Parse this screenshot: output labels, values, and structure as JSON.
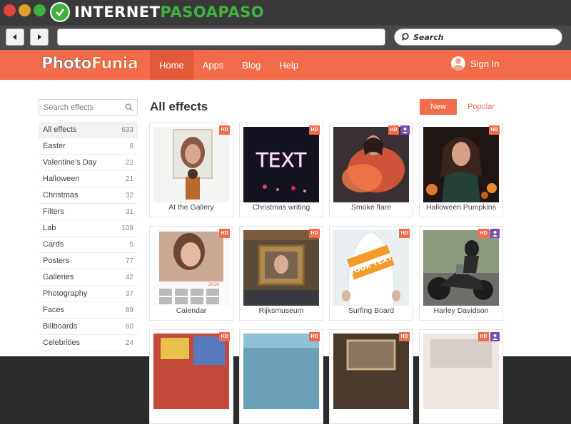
{
  "browser": {
    "brand_prefix": "INTERNET",
    "brand_accent": "PASOAPASO",
    "search_label": "Search",
    "url_value": ""
  },
  "header": {
    "logo_photo": "Photo",
    "logo_funia": "Funia",
    "nav": [
      "Home",
      "Apps",
      "Blog",
      "Help"
    ],
    "active_nav": "Home",
    "signin_label": "Sign In",
    "accent_color": "#f26b4a"
  },
  "sidebar": {
    "search_placeholder": "Search effects",
    "items": [
      {
        "label": "All effects",
        "count": "633"
      },
      {
        "label": "Easter",
        "count": "8"
      },
      {
        "label": "Valentine's Day",
        "count": "22"
      },
      {
        "label": "Halloween",
        "count": "21"
      },
      {
        "label": "Christmas",
        "count": "32"
      },
      {
        "label": "Filters",
        "count": "31"
      },
      {
        "label": "Lab",
        "count": "109"
      },
      {
        "label": "Cards",
        "count": "5"
      },
      {
        "label": "Posters",
        "count": "77"
      },
      {
        "label": "Galleries",
        "count": "42"
      },
      {
        "label": "Photography",
        "count": "37"
      },
      {
        "label": "Faces",
        "count": "89"
      },
      {
        "label": "Billboards",
        "count": "60"
      },
      {
        "label": "Celebrities",
        "count": "24"
      }
    ]
  },
  "main": {
    "title": "All effects",
    "new_label": "New",
    "popular_label": "Popular",
    "cards": [
      {
        "label": "At the Gallery",
        "hd": "HD",
        "user_badge": false
      },
      {
        "label": "Christmas writing",
        "hd": "HD",
        "user_badge": false
      },
      {
        "label": "Smoke flare",
        "hd": "HD",
        "user_badge": true
      },
      {
        "label": "Halloween Pumpkins",
        "hd": "HD",
        "user_badge": false
      },
      {
        "label": "Calendar",
        "hd": "HD",
        "user_badge": false
      },
      {
        "label": "Rijksmuseum",
        "hd": "HD",
        "user_badge": false
      },
      {
        "label": "Surfing Board",
        "hd": "HD",
        "user_badge": false
      },
      {
        "label": "Harley Davidson",
        "hd": "HD",
        "user_badge": true
      },
      {
        "label": "",
        "hd": "HD",
        "user_badge": false
      },
      {
        "label": "",
        "hd": "HD",
        "user_badge": false
      },
      {
        "label": "",
        "hd": "HD",
        "user_badge": false
      },
      {
        "label": "",
        "hd": "HD",
        "user_badge": true
      }
    ],
    "thumb_text": {
      "christmas": "TEXT",
      "surf": "YOUR TEXT",
      "calendar_year": "2016"
    }
  }
}
